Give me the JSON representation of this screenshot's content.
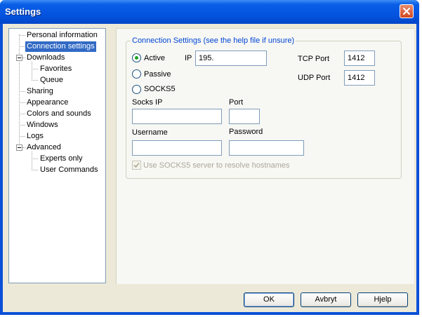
{
  "window": {
    "title": "Settings",
    "close_icon": "close-icon"
  },
  "tree": {
    "items": [
      {
        "label": "Personal information"
      },
      {
        "label": "Connection settings",
        "selected": true
      },
      {
        "label": "Downloads"
      },
      {
        "label": "Favorites"
      },
      {
        "label": "Queue"
      },
      {
        "label": "Sharing"
      },
      {
        "label": "Appearance"
      },
      {
        "label": "Colors and sounds"
      },
      {
        "label": "Windows"
      },
      {
        "label": "Logs"
      },
      {
        "label": "Advanced"
      },
      {
        "label": "Experts only"
      },
      {
        "label": "User Commands"
      }
    ]
  },
  "connection": {
    "group_label": "Connection Settings (see the help file if unsure)",
    "modes": [
      "Active",
      "Passive",
      "SOCKS5"
    ],
    "selected_mode": "Active",
    "ip_label": "IP",
    "ip_value": "195.",
    "tcp_label": "TCP Port",
    "tcp_value": "1412",
    "udp_label": "UDP Port",
    "udp_value": "1412",
    "socks_ip_label": "Socks IP",
    "socks_ip_value": "",
    "port_label": "Port",
    "port_value": "",
    "username_label": "Username",
    "username_value": "",
    "password_label": "Password",
    "password_value": "",
    "resolve_label": "Use SOCKS5 server to resolve hostnames",
    "resolve_checked": true
  },
  "buttons": {
    "ok": "OK",
    "cancel": "Avbryt",
    "help": "Hjelp"
  },
  "colors": {
    "titlebar": "#0454e0",
    "selection": "#316ac5",
    "legend": "#0046d5"
  }
}
